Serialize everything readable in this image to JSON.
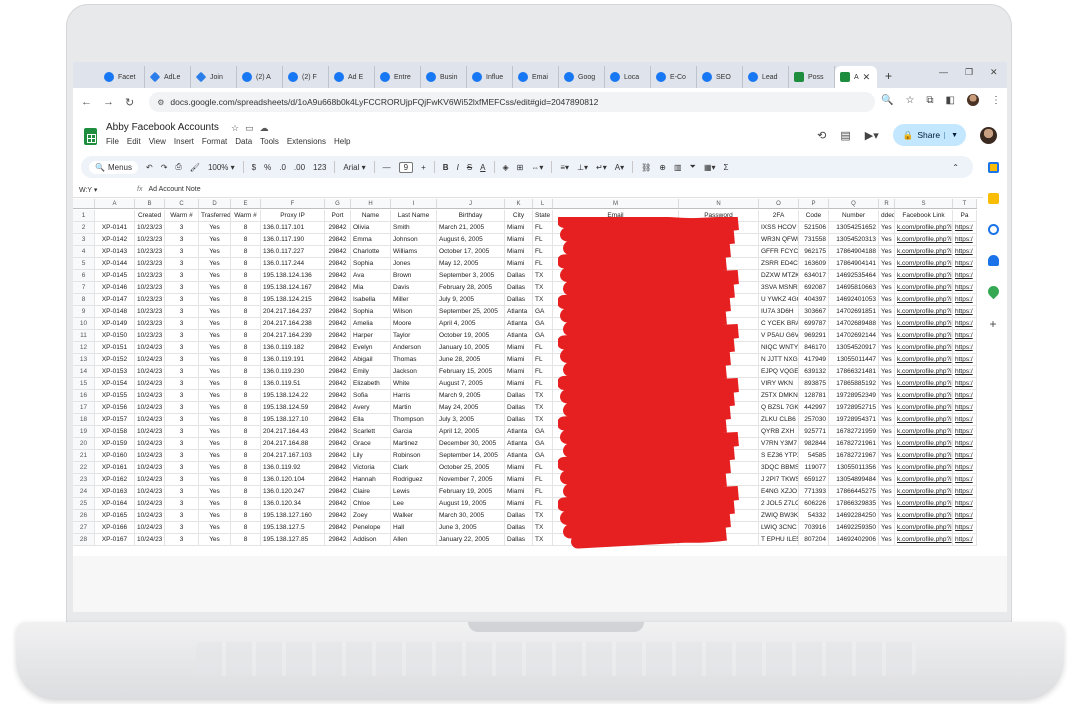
{
  "browser": {
    "tabs": [
      {
        "label": "Facet",
        "icon": "facebook-icon"
      },
      {
        "label": "AdLe",
        "icon": "drive-icon"
      },
      {
        "label": "Join",
        "icon": "drive-icon"
      },
      {
        "label": "(2) A",
        "icon": "facebook-icon"
      },
      {
        "label": "(2) F",
        "icon": "facebook-icon"
      },
      {
        "label": "Ad E",
        "icon": "facebook-icon"
      },
      {
        "label": "Entre",
        "icon": "facebook-icon"
      },
      {
        "label": "Busin",
        "icon": "facebook-icon"
      },
      {
        "label": "Influe",
        "icon": "facebook-icon"
      },
      {
        "label": "Emai",
        "icon": "facebook-icon"
      },
      {
        "label": "Goog",
        "icon": "facebook-icon"
      },
      {
        "label": "Loca",
        "icon": "facebook-icon"
      },
      {
        "label": "E-Co",
        "icon": "facebook-icon"
      },
      {
        "label": "SEO",
        "icon": "facebook-icon"
      },
      {
        "label": "Lead",
        "icon": "facebook-icon"
      },
      {
        "label": "Poss",
        "icon": "sheets-icon"
      }
    ],
    "active_tab": {
      "label": "A",
      "icon": "sheets-icon"
    },
    "url": "docs.google.com/spreadsheets/d/1oA9u668b0k4LyFCCRORUjpFQjFwKV6Wi52lxfMEFCss/edit#gid=2047890812"
  },
  "doc": {
    "title": "Abby Facebook Accounts",
    "menu": [
      "File",
      "Edit",
      "View",
      "Insert",
      "Format",
      "Data",
      "Tools",
      "Extensions",
      "Help"
    ],
    "share_label": "Share"
  },
  "toolbar": {
    "menus_label": "Menus",
    "zoom": "100%",
    "currency": "$",
    "percent": "%",
    "dec_less": ".0",
    "dec_more": ".00",
    "num_format": "123",
    "font": "Arial",
    "font_size": "9",
    "bold": "B",
    "italic": "I",
    "strike": "S",
    "text_color": "A"
  },
  "formula_bar": {
    "cell_ref": "W:Y",
    "content": "Ad Account Note"
  },
  "grid": {
    "columns": [
      "A",
      "B",
      "C",
      "D",
      "E",
      "F",
      "G",
      "H",
      "I",
      "J",
      "K",
      "L",
      "M",
      "N",
      "O",
      "P",
      "Q",
      "R",
      "S",
      "T"
    ],
    "header_row": [
      "",
      "Created",
      "Warm #",
      "Trasferred",
      "Warm #",
      "Proxy IP",
      "Port",
      "Name",
      "Last Name",
      "Birthday",
      "City",
      "State",
      "Email",
      "Password",
      "2FA",
      "Code",
      "Number",
      "dded",
      "Facebook Link",
      "Pa"
    ],
    "rows": [
      [
        "XP-0141",
        "10/23/23",
        "3",
        "Yes",
        "8",
        "136.0.117.101",
        "29842",
        "Olivia",
        "Smith",
        "March 21, 2005",
        "Miami",
        "FL",
        "",
        "",
        "IXSS HCOV",
        "521506",
        "13054251652",
        "Yes",
        "k.com/profile.php?i",
        "https:/"
      ],
      [
        "XP-0142",
        "10/23/23",
        "3",
        "Yes",
        "8",
        "136.0.117.190",
        "29842",
        "Emma",
        "Johnson",
        "August 6, 2005",
        "Miami",
        "FL",
        "",
        "",
        "WR3N QFWN",
        "731558",
        "13054520313",
        "Yes",
        "k.com/profile.php?i",
        "https:/"
      ],
      [
        "XP-0143",
        "10/23/23",
        "3",
        "Yes",
        "8",
        "136.0.117.227",
        "29842",
        "Charlotte",
        "Williams",
        "October 17, 2005",
        "Miami",
        "FL",
        "",
        "",
        "GFFR FCYC",
        "962175",
        "17864904188",
        "Yes",
        "k.com/profile.php?i",
        "https:/"
      ],
      [
        "XP-0144",
        "10/23/23",
        "3",
        "Yes",
        "8",
        "136.0.117.244",
        "29842",
        "Sophia",
        "Jones",
        "May 12, 2005",
        "Miami",
        "FL",
        "",
        "",
        "ZSRR ED4C",
        "163609",
        "17864904141",
        "Yes",
        "k.com/profile.php?i",
        "https:/"
      ],
      [
        "XP-0145",
        "10/23/23",
        "3",
        "Yes",
        "8",
        "195.138.124.136",
        "29842",
        "Ava",
        "Brown",
        "September 3, 2005",
        "Dallas",
        "TX",
        "",
        "",
        "DZXW MTZK",
        "634017",
        "14692535464",
        "Yes",
        "k.com/profile.php?i",
        "https:/"
      ],
      [
        "XP-0146",
        "10/23/23",
        "3",
        "Yes",
        "8",
        "195.138.124.167",
        "29842",
        "Mia",
        "Davis",
        "February 28, 2005",
        "Dallas",
        "TX",
        "",
        "",
        "3SVA MSNR",
        "692087",
        "14695810663",
        "Yes",
        "k.com/profile.php?i",
        "https:/"
      ],
      [
        "XP-0147",
        "10/23/23",
        "3",
        "Yes",
        "8",
        "195.138.124.215",
        "29842",
        "Isabella",
        "Miller",
        "July 9, 2005",
        "Dallas",
        "TX",
        "",
        "",
        "U YWKZ 4GG",
        "404397",
        "14692401053",
        "Yes",
        "k.com/profile.php?i",
        "https:/"
      ],
      [
        "XP-0148",
        "10/23/23",
        "3",
        "Yes",
        "8",
        "204.217.164.237",
        "29842",
        "Sophia",
        "Wilson",
        "September 25, 2005",
        "Atlanta",
        "GA",
        "",
        "",
        "IU7A 3D6H",
        "303667",
        "14702691851",
        "Yes",
        "k.com/profile.php?i",
        "https:/"
      ],
      [
        "XP-0149",
        "10/23/23",
        "3",
        "Yes",
        "8",
        "204.217.164.238",
        "29842",
        "Amelia",
        "Moore",
        "April 4, 2005",
        "Atlanta",
        "GA",
        "",
        "",
        "C YCEK BRA",
        "699787",
        "14702689488",
        "Yes",
        "k.com/profile.php?i",
        "https:/"
      ],
      [
        "XP-0150",
        "10/23/23",
        "3",
        "Yes",
        "8",
        "204.217.164.239",
        "29842",
        "Harper",
        "Taylor",
        "October 19, 2005",
        "Atlanta",
        "GA",
        "",
        "",
        "V P5AU G6V",
        "969291",
        "14702692144",
        "Yes",
        "k.com/profile.php?i",
        "https:/"
      ],
      [
        "XP-0151",
        "10/24/23",
        "3",
        "Yes",
        "8",
        "136.0.119.182",
        "29842",
        "Evelyn",
        "Anderson",
        "January 10, 2005",
        "Miami",
        "FL",
        "",
        "",
        "NIQC WNTY",
        "846170",
        "13054520917",
        "Yes",
        "k.com/profile.php?i",
        "https:/"
      ],
      [
        "XP-0152",
        "10/24/23",
        "3",
        "Yes",
        "8",
        "136.0.119.191",
        "29842",
        "Abigail",
        "Thomas",
        "June 28, 2005",
        "Miami",
        "FL",
        "",
        "",
        "N JJTT NXGI",
        "417949",
        "13055011447",
        "Yes",
        "k.com/profile.php?i",
        "https:/"
      ],
      [
        "XP-0153",
        "10/24/23",
        "3",
        "Yes",
        "8",
        "136.0.119.230",
        "29842",
        "Emily",
        "Jackson",
        "February 15, 2005",
        "Miami",
        "FL",
        "",
        "",
        "EJPQ VQGE",
        "639132",
        "17866321481",
        "Yes",
        "k.com/profile.php?i",
        "https:/"
      ],
      [
        "XP-0154",
        "10/24/23",
        "3",
        "Yes",
        "8",
        "136.0.119.51",
        "29842",
        "Elizabeth",
        "White",
        "August 7, 2005",
        "Miami",
        "FL",
        "",
        "",
        "VIRY WKN",
        "893875",
        "17865885192",
        "Yes",
        "k.com/profile.php?i",
        "https:/"
      ],
      [
        "XP-0155",
        "10/24/23",
        "3",
        "Yes",
        "8",
        "195.138.124.22",
        "29842",
        "Sofia",
        "Harris",
        "March 9, 2005",
        "Dallas",
        "TX",
        "",
        "",
        "Z5TX DMKN",
        "128781",
        "19728952349",
        "Yes",
        "k.com/profile.php?i",
        "https:/"
      ],
      [
        "XP-0156",
        "10/24/23",
        "3",
        "Yes",
        "8",
        "195.138.124.59",
        "29842",
        "Avery",
        "Martin",
        "May 24, 2005",
        "Dallas",
        "TX",
        "",
        "",
        "Q BZSL 7GK",
        "442997",
        "19728952715",
        "Yes",
        "k.com/profile.php?i",
        "https:/"
      ],
      [
        "XP-0157",
        "10/24/23",
        "3",
        "Yes",
        "8",
        "195.138.127.10",
        "29842",
        "Ella",
        "Thompson",
        "July 3, 2005",
        "Dallas",
        "TX",
        "",
        "",
        "ZLKU CLB6",
        "257030",
        "19728954371",
        "Yes",
        "k.com/profile.php?i",
        "https:/"
      ],
      [
        "XP-0158",
        "10/24/23",
        "3",
        "Yes",
        "8",
        "204.217.164.43",
        "29842",
        "Scarlett",
        "Garcia",
        "April 12, 2005",
        "Atlanta",
        "GA",
        "",
        "",
        "QYRB ZXH",
        "925771",
        "16782721959",
        "Yes",
        "k.com/profile.php?i",
        "https:/"
      ],
      [
        "XP-0159",
        "10/24/23",
        "3",
        "Yes",
        "8",
        "204.217.164.88",
        "29842",
        "Grace",
        "Martinez",
        "December 30, 2005",
        "Atlanta",
        "GA",
        "",
        "",
        "V7RN Y3M7",
        "982844",
        "16782721961",
        "Yes",
        "k.com/profile.php?i",
        "https:/"
      ],
      [
        "XP-0160",
        "10/24/23",
        "3",
        "Yes",
        "8",
        "204.217.167.103",
        "29842",
        "Lily",
        "Robinson",
        "September 14, 2005",
        "Atlanta",
        "GA",
        "",
        "",
        "S EZ36 YTPX",
        "54585",
        "16782721967",
        "Yes",
        "k.com/profile.php?i",
        "https:/"
      ],
      [
        "XP-0161",
        "10/24/23",
        "3",
        "Yes",
        "8",
        "136.0.119.92",
        "29842",
        "Victoria",
        "Clark",
        "October 25, 2005",
        "Miami",
        "FL",
        "",
        "",
        "3DQC BBMS",
        "119077",
        "13055011356",
        "Yes",
        "k.com/profile.php?i",
        "https:/"
      ],
      [
        "XP-0162",
        "10/24/23",
        "3",
        "Yes",
        "8",
        "136.0.120.104",
        "29842",
        "Hannah",
        "Rodriguez",
        "November 7, 2005",
        "Miami",
        "FL",
        "",
        "",
        "J 2PI7 TKWS",
        "659127",
        "13054899484",
        "Yes",
        "k.com/profile.php?i",
        "https:/"
      ],
      [
        "XP-0163",
        "10/24/23",
        "3",
        "Yes",
        "8",
        "136.0.120.247",
        "29842",
        "Claire",
        "Lewis",
        "February 19, 2005",
        "Miami",
        "FL",
        "",
        "",
        "E4NG XZJO",
        "771393",
        "17866445275",
        "Yes",
        "k.com/profile.php?i",
        "https:/"
      ],
      [
        "XP-0164",
        "10/24/23",
        "3",
        "Yes",
        "8",
        "136.0.120.34",
        "29842",
        "Chloe",
        "Lee",
        "August 19, 2005",
        "Miami",
        "FL",
        "",
        "",
        "2 JOL5 Z7LC",
        "606226",
        "17866329835",
        "Yes",
        "k.com/profile.php?i",
        "https:/"
      ],
      [
        "XP-0165",
        "10/24/23",
        "3",
        "Yes",
        "8",
        "195.138.127.160",
        "29842",
        "Zoey",
        "Walker",
        "March 30, 2005",
        "Dallas",
        "TX",
        "",
        "",
        "ZWIQ BW3K",
        "54332",
        "14692284250",
        "Yes",
        "k.com/profile.php?i",
        "https:/"
      ],
      [
        "XP-0166",
        "10/24/23",
        "3",
        "Yes",
        "8",
        "195.138.127.5",
        "29842",
        "Penelope",
        "Hall",
        "June 3, 2005",
        "Dallas",
        "TX",
        "",
        "",
        "LWIQ 3CNC",
        "703916",
        "14692259350",
        "Yes",
        "k.com/profile.php?i",
        "https:/"
      ],
      [
        "XP-0167",
        "10/24/23",
        "3",
        "Yes",
        "8",
        "195.138.127.85",
        "29842",
        "Addison",
        "Allen",
        "January 22, 2005",
        "Dallas",
        "TX",
        "",
        "",
        "T EPHU ILE5",
        "807204",
        "14692402906",
        "Yes",
        "k.com/profile.php?i",
        "https:/"
      ]
    ]
  },
  "colors": {
    "sheets_green": "#1e8e3e",
    "share_bg": "#c2e7ff",
    "redaction": "#e62020",
    "link": "#1155cc"
  }
}
